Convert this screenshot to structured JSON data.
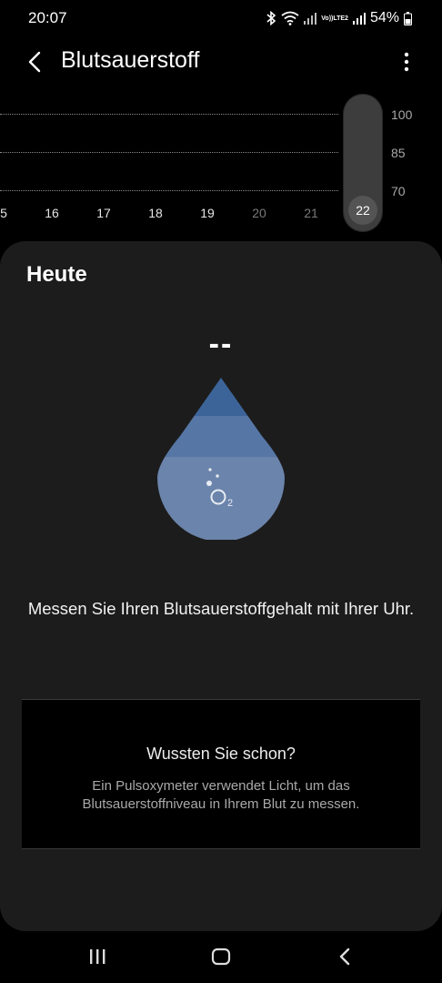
{
  "status_bar": {
    "time": "20:07",
    "network_label_top": "Vo))",
    "network_label_bottom": "LTE2",
    "battery": "54%"
  },
  "header": {
    "title": "Blutsauerstoff"
  },
  "chart": {
    "y_labels": [
      "100",
      "85",
      "70"
    ],
    "x_labels": [
      "5",
      "16",
      "17",
      "18",
      "19",
      "20",
      "21"
    ],
    "selected_day": "22"
  },
  "today": {
    "title": "Heute",
    "value": "--",
    "o2_symbol": "O",
    "o2_subscript": "2",
    "message": "Messen Sie Ihren Blutsauerstoffgehalt mit Ihrer Uhr.",
    "tip_title": "Wussten Sie schon?",
    "tip_text": "Ein Pulsoxymeter verwendet Licht, um das Blutsauerstoffniveau in Ihrem Blut zu messen."
  },
  "colors": {
    "background": "#000000",
    "card": "#1c1c1c",
    "drop_top": "#3d6499",
    "drop_mid": "#5676a5",
    "drop_bottom": "#6b84ab"
  }
}
